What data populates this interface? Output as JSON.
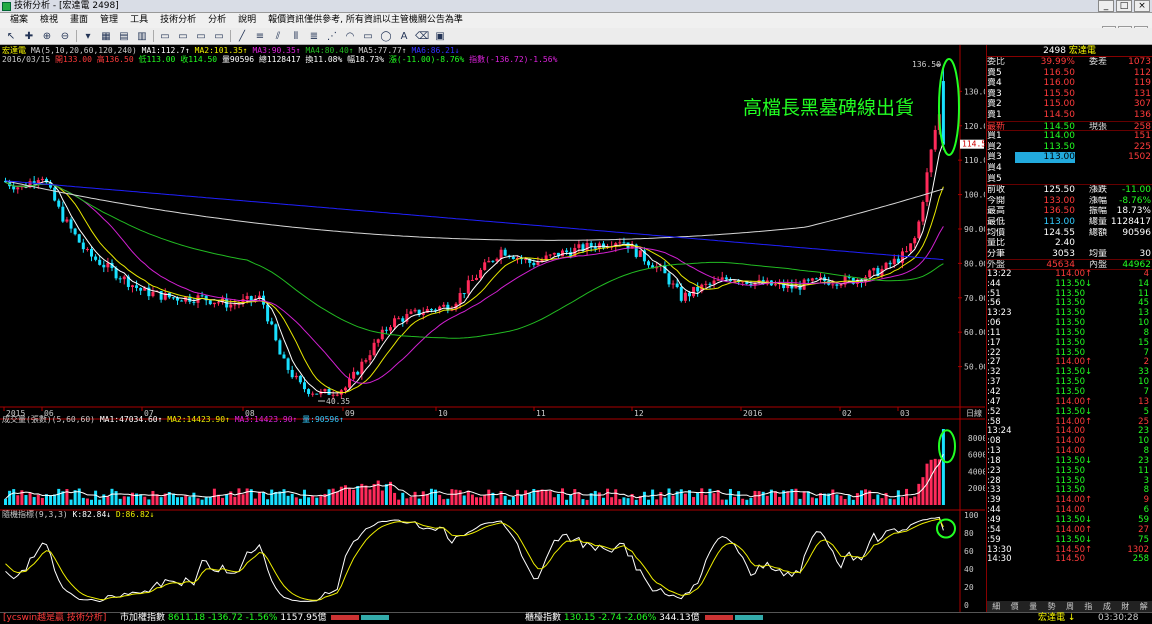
{
  "window": {
    "title": "技術分析 - [宏達電 2498]"
  },
  "menu": [
    "檔案",
    "檢視",
    "畫面",
    "管理",
    "工具",
    "技術分析",
    "分析",
    "說明",
    "報價資訊僅供參考, 所有資訊以主管機關公告為準"
  ],
  "chart": {
    "ma_header": {
      "name": "宏達電",
      "params": "MA(5,10,20,60,120,240)",
      "ma1": "MA1:112.7↑",
      "ma2": "MA2:101.35↑",
      "ma3": "MA3:90.35↑",
      "ma4": "MA4:80.40↑",
      "ma5": "MA5:77.77↑",
      "ma6": "MA6:86.21↓"
    },
    "bar_header": {
      "date": "2016/03/15",
      "open": "開133.00",
      "high": "高136.50",
      "low": "低113.00",
      "close": "收114.50",
      "vol": "量90596",
      "amt": "總1128417",
      "turn": "換11.08%",
      "amp": "幅18.73%",
      "chg": "漲(-11.00)-8.76%",
      "idx": "指數(-136.72)-1.56%"
    },
    "annotation": "高檔長黑墓碑線出貨",
    "max_label": "136.50",
    "min_label": "40.35",
    "cur_price_tag": "114.50",
    "price_ticks": [
      "130.00",
      "120.00",
      "110.00",
      "100.00",
      "90.00",
      "80.00",
      "70.00",
      "60.00",
      "50.00"
    ],
    "date_labels": [
      "2015",
      "06",
      "07",
      "08",
      "09",
      "10",
      "11",
      "12",
      "2016",
      "02",
      "03"
    ],
    "date_unit": "日線",
    "vol_header": {
      "name": "成交量(張數)(5,60,60)",
      "ma1": "MA1:47034.60↑",
      "ma2": "MA2:14423.90↑",
      "ma3": "MA3:14423.90↑",
      "vol": "量:90596↑"
    },
    "vol_ticks": [
      "80000",
      "60000",
      "40000",
      "20000",
      "0"
    ],
    "kd_header": {
      "name": "隨機指標(9,3,3)",
      "k": "K:82.84↓",
      "d": "D:86.82↓"
    },
    "kd_ticks": [
      "100",
      "80",
      "60",
      "40",
      "20",
      "0"
    ],
    "colors": {
      "up": "#ff2a5a",
      "down": "#19e0ff",
      "ma5": "#ffffff",
      "ma10": "#e8e800",
      "ma20": "#d020d0",
      "ma60": "#22bb22",
      "ma120": "#d8d8d8",
      "ma240": "#2020ff",
      "highlight": "#22ff22"
    }
  },
  "quote": {
    "code": "2498",
    "name": "宏達電",
    "weibi_l": "委比",
    "weibi_v": "39.99%",
    "weicha_l": "委差",
    "weicha_v": "1073",
    "asks": [
      {
        "l": "賣5",
        "p": "116.50",
        "q": "112"
      },
      {
        "l": "賣4",
        "p": "116.00",
        "q": "119"
      },
      {
        "l": "賣3",
        "p": "115.50",
        "q": "131"
      },
      {
        "l": "賣2",
        "p": "115.00",
        "q": "307"
      },
      {
        "l": "賣1",
        "p": "114.50",
        "q": "136"
      }
    ],
    "last": {
      "l": "最新",
      "p": "114.50",
      "s": "現張",
      "q": "258"
    },
    "bids": [
      {
        "l": "買1",
        "p": "114.00",
        "q": "151"
      },
      {
        "l": "買2",
        "p": "113.50",
        "q": "225"
      },
      {
        "l": "買3",
        "p": "113.00",
        "q": "1502"
      },
      {
        "l": "買4",
        "p": "",
        "q": ""
      },
      {
        "l": "買5",
        "p": "",
        "q": ""
      }
    ],
    "stats": [
      {
        "a": "前收",
        "b": "125.50",
        "c": "漲跌",
        "d": "-11.00"
      },
      {
        "a": "今開",
        "b": "133.00",
        "c": "漲幅",
        "d": "-8.76%"
      },
      {
        "a": "最高",
        "b": "136.50",
        "c": "振幅",
        "d": "18.73%"
      },
      {
        "a": "最低",
        "b": "113.00",
        "c": "總量",
        "d": "1128417"
      },
      {
        "a": "均價",
        "b": "124.55",
        "c": "總額",
        "d": "90596"
      },
      {
        "a": "量比",
        "b": "2.40",
        "c": "",
        "d": ""
      },
      {
        "a": "分筆",
        "b": "3053",
        "c": "均量",
        "d": "30"
      }
    ],
    "outer_l": "外盤",
    "outer_v": "45634",
    "inner_l": "內盤",
    "inner_v": "44962",
    "ticks": [
      {
        "t": "13:22",
        "p": "114.00",
        "a": "↑",
        "q": "4"
      },
      {
        "t": ":44",
        "p": "113.50",
        "a": "↓",
        "q": "14"
      },
      {
        "t": ":51",
        "p": "113.50",
        "a": "",
        "q": "11"
      },
      {
        "t": ":56",
        "p": "113.50",
        "a": "",
        "q": "45"
      },
      {
        "t": "13:23",
        "p": "113.50",
        "a": "",
        "q": "13"
      },
      {
        "t": ":06",
        "p": "113.50",
        "a": "",
        "q": "10"
      },
      {
        "t": ":11",
        "p": "113.50",
        "a": "",
        "q": "8"
      },
      {
        "t": ":17",
        "p": "113.50",
        "a": "",
        "q": "15"
      },
      {
        "t": ":22",
        "p": "113.50",
        "a": "",
        "q": "7"
      },
      {
        "t": ":27",
        "p": "114.00",
        "a": "↑",
        "q": "2"
      },
      {
        "t": ":32",
        "p": "113.50",
        "a": "↓",
        "q": "33"
      },
      {
        "t": ":37",
        "p": "113.50",
        "a": "",
        "q": "10"
      },
      {
        "t": ":42",
        "p": "113.50",
        "a": "",
        "q": "7"
      },
      {
        "t": ":47",
        "p": "114.00",
        "a": "↑",
        "q": "13"
      },
      {
        "t": ":52",
        "p": "113.50",
        "a": "↓",
        "q": "5"
      },
      {
        "t": ":58",
        "p": "114.00",
        "a": "↑",
        "q": "25"
      },
      {
        "t": "13:24",
        "p": "114.00",
        "a": "",
        "q": "23"
      },
      {
        "t": ":08",
        "p": "114.00",
        "a": "",
        "q": "10"
      },
      {
        "t": ":13",
        "p": "114.00",
        "a": "",
        "q": "8"
      },
      {
        "t": ":18",
        "p": "113.50",
        "a": "↓",
        "q": "23"
      },
      {
        "t": ":23",
        "p": "113.50",
        "a": "",
        "q": "11"
      },
      {
        "t": ":28",
        "p": "113.50",
        "a": "",
        "q": "3"
      },
      {
        "t": ":33",
        "p": "113.50",
        "a": "",
        "q": "8"
      },
      {
        "t": ":39",
        "p": "114.00",
        "a": "↑",
        "q": "9"
      },
      {
        "t": ":44",
        "p": "114.00",
        "a": "",
        "q": "6"
      },
      {
        "t": ":49",
        "p": "113.50",
        "a": "↓",
        "q": "59"
      },
      {
        "t": ":54",
        "p": "114.00",
        "a": "↑",
        "q": "27"
      },
      {
        "t": ":59",
        "p": "113.50",
        "a": "↓",
        "q": "75"
      },
      {
        "t": "13:30",
        "p": "114.50",
        "a": "↑",
        "q": "1302"
      },
      {
        "t": "14:30",
        "p": "114.50",
        "a": "",
        "q": "258"
      }
    ],
    "tabs": [
      "細",
      "價",
      "量",
      "勢",
      "周",
      "指",
      "成",
      "財",
      "解"
    ]
  },
  "status": {
    "brand": "[ycswin越是贏 技術分析]",
    "idx1_name": "市加權指數",
    "idx1_val": "8611.18",
    "idx1_chg": "-136.72",
    "idx1_pct": "-1.56%",
    "idx1_amt": "1157.95億",
    "idx2_name": "櫃檯指數",
    "idx2_val": "130.15",
    "idx2_chg": "-2.74",
    "idx2_pct": "-2.06%",
    "idx2_amt": "344.13億",
    "stock": "宏達電 ↓",
    "time": "03:30:28"
  }
}
